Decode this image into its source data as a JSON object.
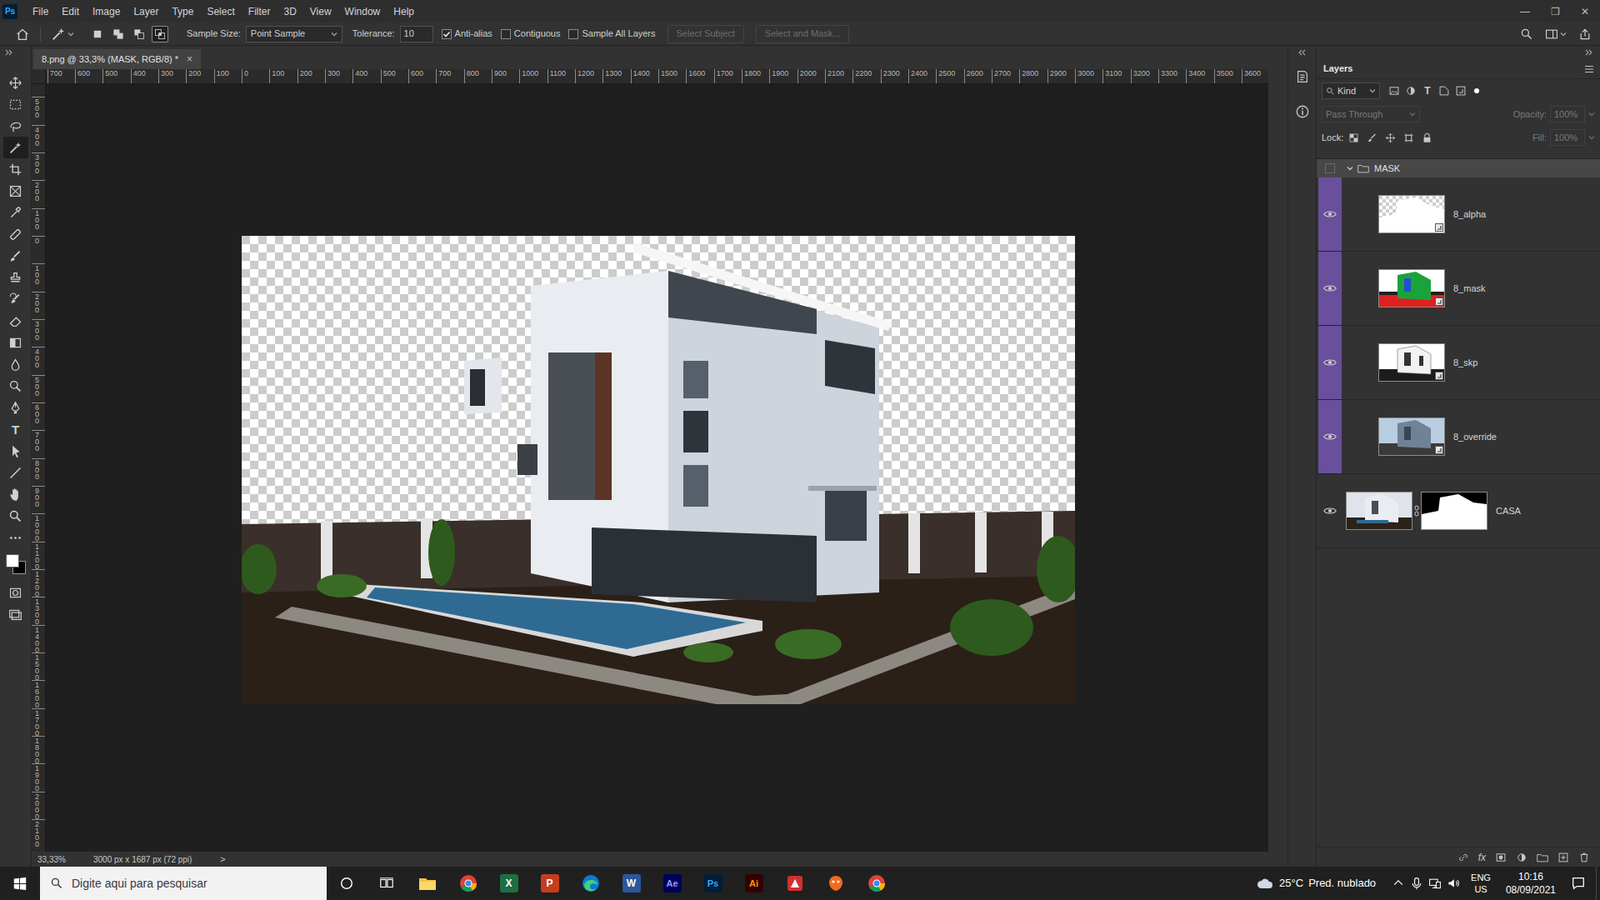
{
  "app": {
    "logo": "Ps",
    "menus": [
      "File",
      "Edit",
      "Image",
      "Layer",
      "Type",
      "Select",
      "Filter",
      "3D",
      "View",
      "Window",
      "Help"
    ],
    "window_controls": [
      "—",
      "❐",
      "✕"
    ]
  },
  "options_bar": {
    "modes": [
      {
        "kind": "new",
        "selected": false
      },
      {
        "kind": "add",
        "selected": false
      },
      {
        "kind": "subtract",
        "selected": false
      },
      {
        "kind": "intersect",
        "selected": true
      }
    ],
    "sample_size": {
      "label": "Sample Size:",
      "value": "Point Sample"
    },
    "tolerance": {
      "label": "Tolerance:",
      "value": "10"
    },
    "checkboxes": [
      {
        "label": "Anti-alias",
        "checked": true
      },
      {
        "label": "Contiguous",
        "checked": false
      },
      {
        "label": "Sample All Layers",
        "checked": false
      }
    ],
    "buttons": [
      {
        "label": "Select Subject",
        "disabled": true
      },
      {
        "label": "Select and Mask...",
        "disabled": true
      }
    ]
  },
  "document": {
    "tab": "8.png @ 33,3% (MASK, RGB/8) *",
    "close": "×"
  },
  "rulers": {
    "horizontal": [
      "700",
      "600",
      "500",
      "400",
      "300",
      "200",
      "100",
      "0",
      "100",
      "200",
      "300",
      "400",
      "500",
      "600",
      "700",
      "800",
      "900",
      "1000",
      "1100",
      "1200",
      "1300",
      "1400",
      "1500",
      "1600",
      "1700",
      "1800",
      "1900",
      "2000",
      "2100",
      "2200",
      "2300",
      "2400",
      "2500",
      "2600",
      "2700",
      "2800",
      "2900",
      "3000",
      "3100",
      "3200",
      "3300",
      "3400",
      "3500",
      "3600"
    ],
    "vertical": [
      "500",
      "400",
      "300",
      "200",
      "100",
      "0",
      "100",
      "200",
      "300",
      "400",
      "500",
      "600",
      "700",
      "800",
      "900",
      "1000",
      "1100",
      "1200",
      "1300",
      "1400",
      "1500",
      "1600",
      "1700",
      "1800",
      "1900",
      "2000",
      "2100"
    ]
  },
  "tools": [
    {
      "kind": "move",
      "selected": false
    },
    {
      "kind": "marquee",
      "selected": false
    },
    {
      "kind": "lasso",
      "selected": false
    },
    {
      "kind": "magic-wand",
      "selected": true
    },
    {
      "kind": "crop",
      "selected": false
    },
    {
      "kind": "frame",
      "selected": false
    },
    {
      "kind": "eyedropper",
      "selected": false
    },
    {
      "kind": "healing",
      "selected": false
    },
    {
      "kind": "brush",
      "selected": false
    },
    {
      "kind": "stamp",
      "selected": false
    },
    {
      "kind": "history-brush",
      "selected": false
    },
    {
      "kind": "eraser",
      "selected": false
    },
    {
      "kind": "gradient",
      "selected": false
    },
    {
      "kind": "blur",
      "selected": false
    },
    {
      "kind": "dodge",
      "selected": false
    },
    {
      "kind": "pen",
      "selected": false
    },
    {
      "kind": "type",
      "label": "T",
      "selected": false
    },
    {
      "kind": "path-select",
      "selected": false
    },
    {
      "kind": "line",
      "selected": false
    },
    {
      "kind": "hand",
      "selected": false
    },
    {
      "kind": "zoom",
      "selected": false
    },
    {
      "kind": "more",
      "selected": false
    },
    {
      "kind": "quickmask",
      "selected": false
    },
    {
      "kind": "screenmode",
      "selected": false
    }
  ],
  "swatches": [
    {
      "color": "#ffffff"
    },
    {
      "color": "#000000"
    }
  ],
  "status_bar": {
    "zoom": "33,33%",
    "size": "3000 px x 1687 px (72 ppi)",
    "arrow": ">"
  },
  "layers_panel": {
    "title": "Layers",
    "filter": {
      "value": "Kind",
      "type_filter": "T"
    },
    "blend": {
      "value": "Pass Through",
      "disabled": true
    },
    "opacity": {
      "label": "Opacity:",
      "value": "100%",
      "disabled": true
    },
    "lock_label": "Lock:",
    "fill": {
      "label": "Fill:",
      "value": "100%",
      "disabled": true
    },
    "group": {
      "name": "MASK",
      "expanded": true,
      "visible": false,
      "selected": true
    },
    "layers": [
      {
        "name": "8_alpha",
        "kind": "alpha",
        "visible": true,
        "selected": false,
        "color": "#6a4f9c"
      },
      {
        "name": "8_mask",
        "kind": "mask",
        "visible": true,
        "selected": false,
        "color": "#6a4f9c"
      },
      {
        "name": "8_skp",
        "kind": "skp",
        "visible": true,
        "selected": false,
        "color": "#6a4f9c"
      },
      {
        "name": "8_override",
        "kind": "override",
        "visible": true,
        "selected": false,
        "color": "#6a4f9c"
      }
    ],
    "base_layer": {
      "name": "CASA",
      "kind": "photo",
      "visible": true,
      "selected": false,
      "mask": true
    },
    "footer_fx": "fx"
  },
  "taskbar": {
    "search": "Digite aqui para pesquisar",
    "apps": [
      {
        "kind": "explorer"
      },
      {
        "kind": "chrome"
      },
      {
        "kind": "excel",
        "label": "X"
      },
      {
        "kind": "powerpoint",
        "label": "P"
      },
      {
        "kind": "edge"
      },
      {
        "kind": "word",
        "label": "W"
      },
      {
        "kind": "ae",
        "label": "Ae"
      },
      {
        "kind": "ps",
        "label": "Ps"
      },
      {
        "kind": "ai",
        "label": "Ai"
      },
      {
        "kind": "sketchup"
      },
      {
        "kind": "orange"
      },
      {
        "kind": "chrome"
      }
    ],
    "weather": {
      "temp": "25°C",
      "text": "Pred. nublado"
    },
    "lang": [
      "ENG",
      "US"
    ],
    "time": "10:16",
    "date": "08/09/2021"
  }
}
